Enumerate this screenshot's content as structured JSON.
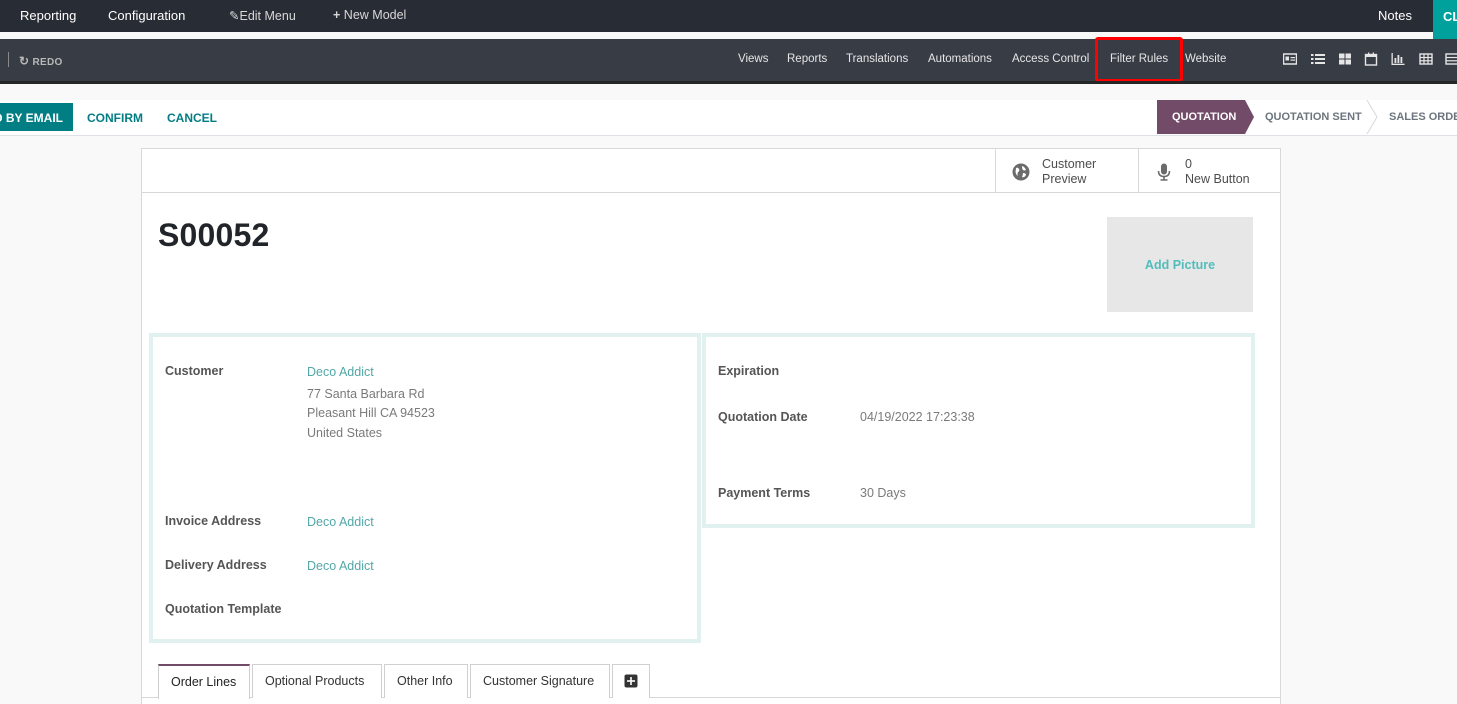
{
  "topbar": {
    "reporting": "Reporting",
    "configuration": "Configuration",
    "edit_menu": "Edit Menu",
    "new_model": "New Model",
    "notes": "Notes",
    "cl": "CL"
  },
  "studio": {
    "redo": "REDO",
    "items": [
      "Views",
      "Reports",
      "Translations",
      "Automations",
      "Access Control",
      "Filter Rules",
      "Website"
    ]
  },
  "actions": {
    "send_by_email": "SEND BY EMAIL",
    "confirm": "CONFIRM",
    "cancel": "CANCEL"
  },
  "statusbar": {
    "stages": [
      "QUOTATION",
      "QUOTATION SENT",
      "SALES ORDER"
    ],
    "active": "QUOTATION"
  },
  "buttonbox": {
    "customer_preview_line1": "Customer",
    "customer_preview_line2": "Preview",
    "new_button_count": "0",
    "new_button_label": "New Button"
  },
  "record": {
    "name": "S00052",
    "add_picture": "Add Picture"
  },
  "left_group": {
    "customer_label": "Customer",
    "customer_name": "Deco Addict",
    "address_line1": "77 Santa Barbara Rd",
    "address_line2": "Pleasant Hill CA 94523",
    "address_line3": "United States",
    "invoice_label": "Invoice Address",
    "invoice_value": "Deco Addict",
    "delivery_label": "Delivery Address",
    "delivery_value": "Deco Addict",
    "template_label": "Quotation Template"
  },
  "right_group": {
    "expiration_label": "Expiration",
    "quotation_date_label": "Quotation Date",
    "quotation_date_value": "04/19/2022 17:23:38",
    "payment_terms_label": "Payment Terms",
    "payment_terms_value": "30 Days"
  },
  "tabs": [
    "Order Lines",
    "Optional Products",
    "Other Info",
    "Customer Signature"
  ],
  "colors": {
    "brand": "#714b67",
    "teal": "#017e84",
    "highlight": "#ff0000"
  }
}
